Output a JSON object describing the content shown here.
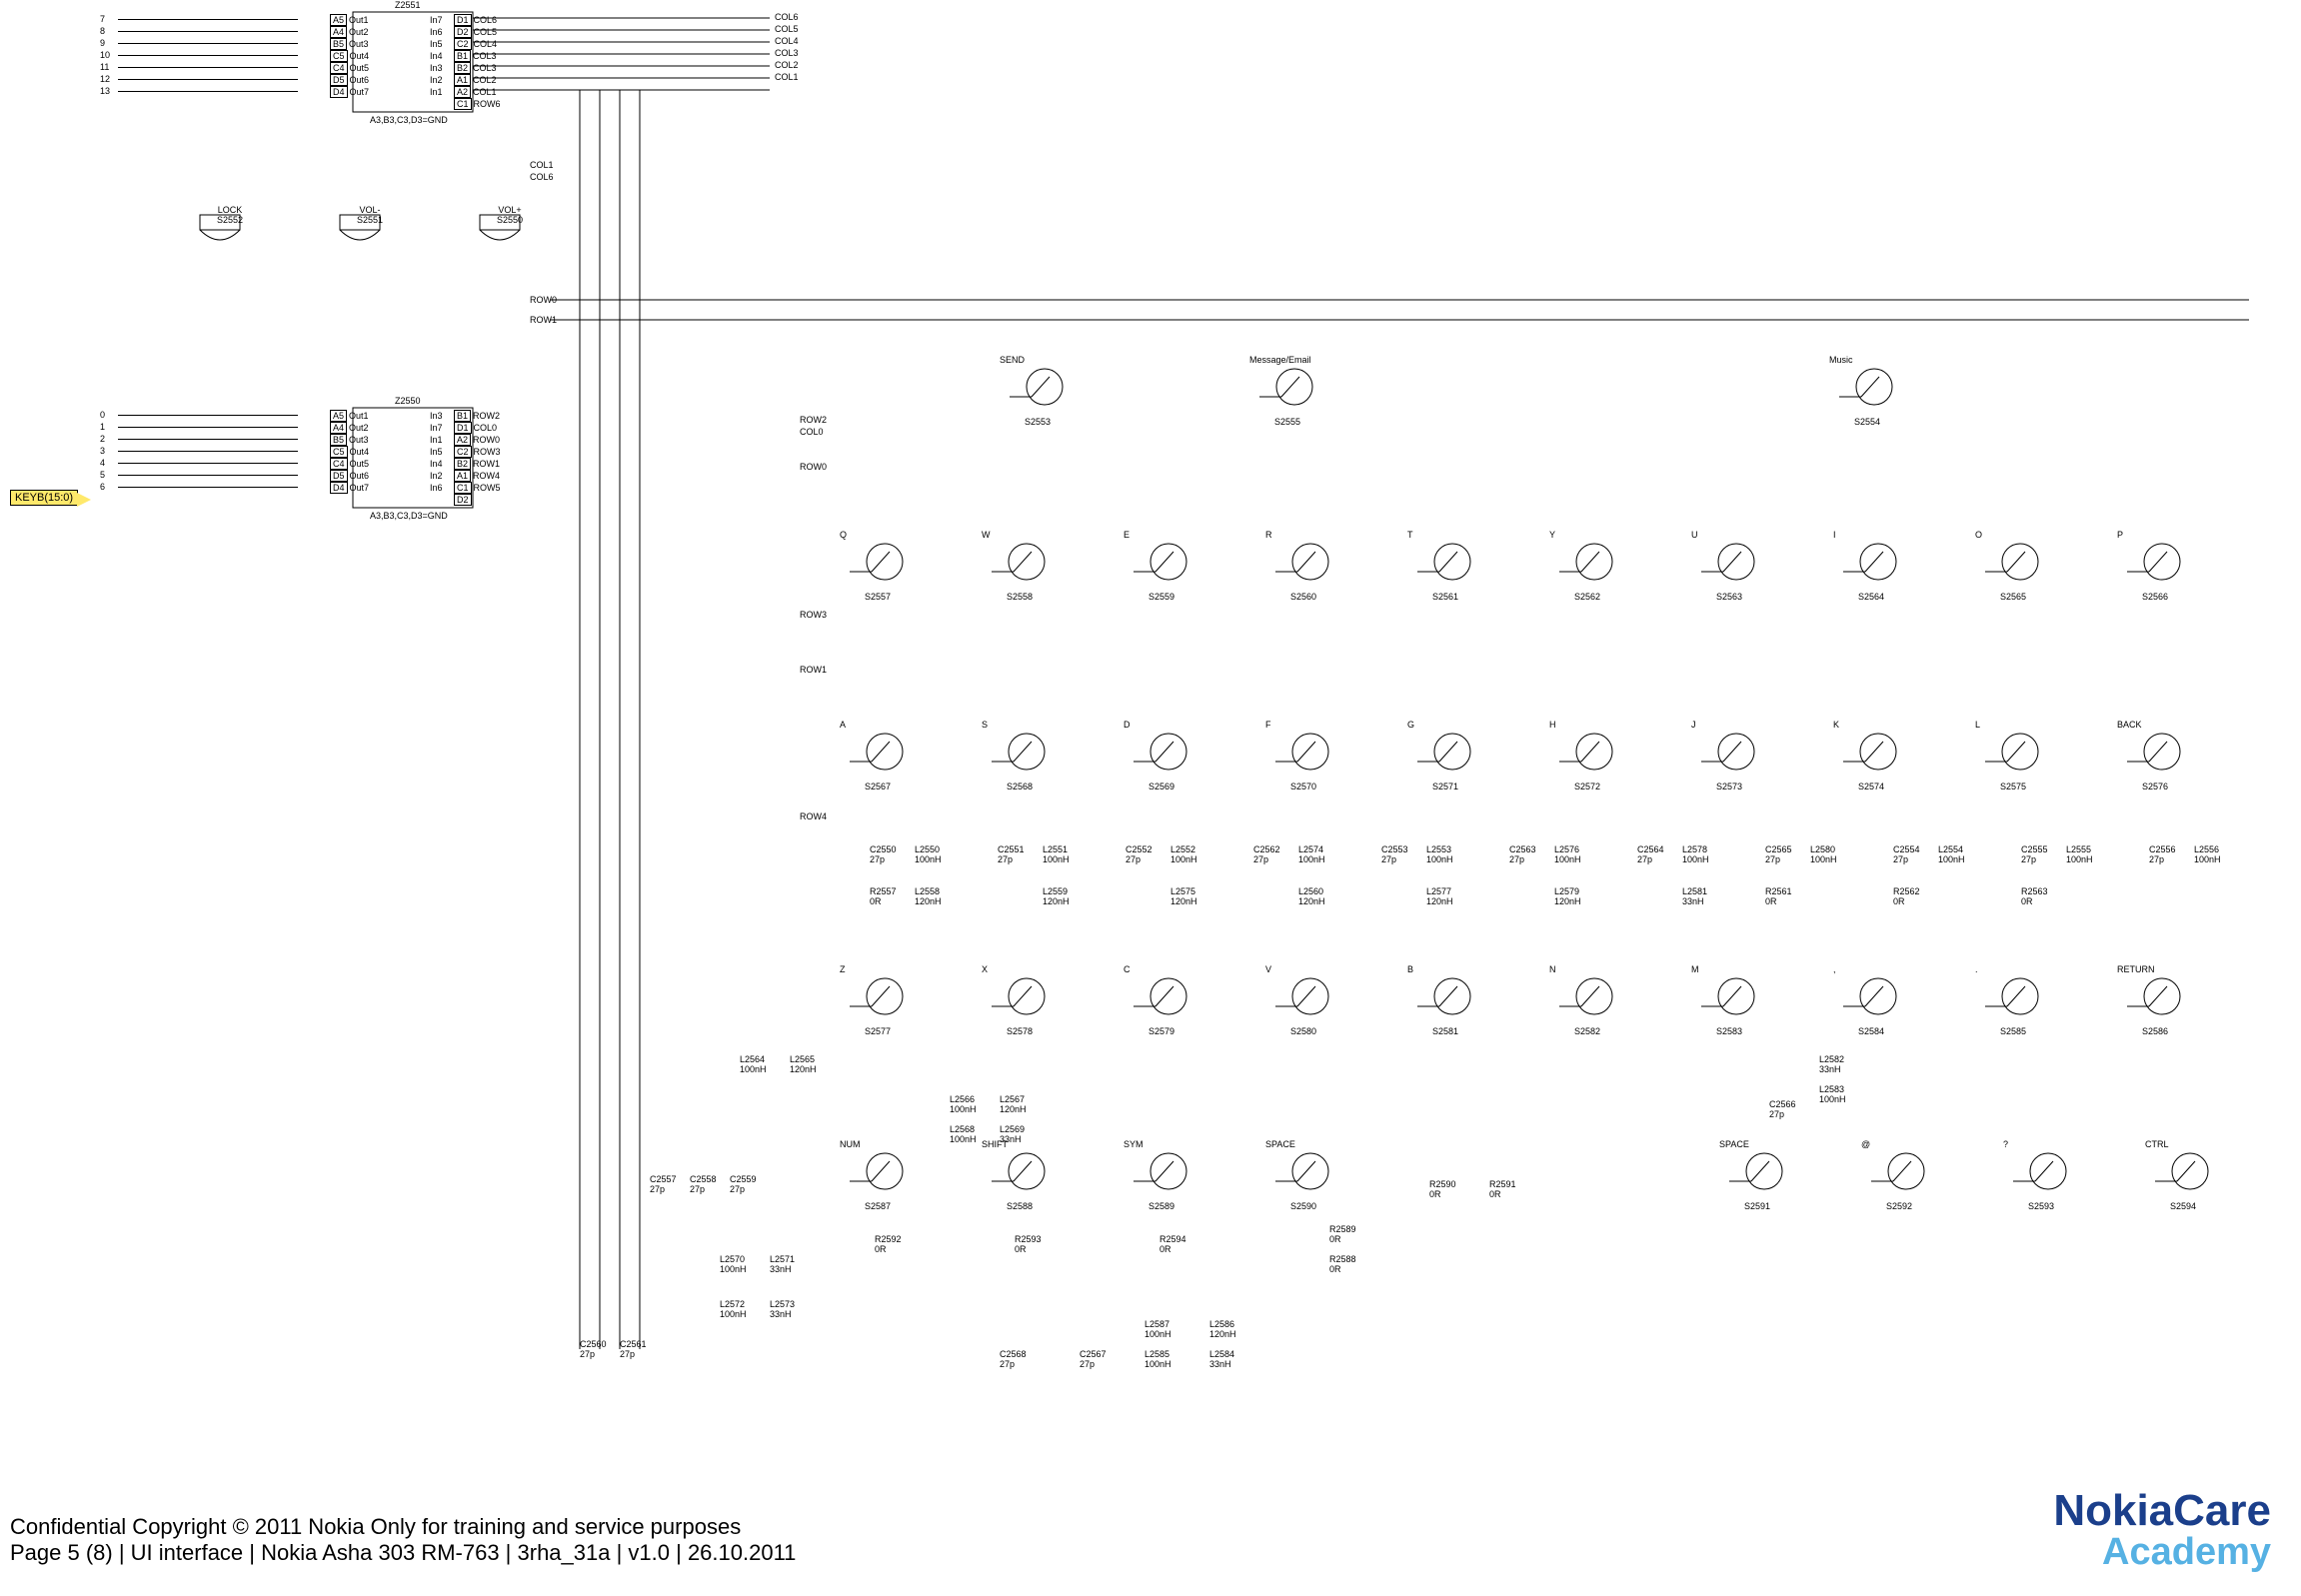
{
  "footer": {
    "copyright": "Confidential Copyright © 2011 Nokia Only for training and service purposes",
    "pageinfo": "Page 5 (8)  |  UI interface  |  Nokia Asha 303 RM-763  |  3rha_31a  |  v1.0  |  26.10.2011"
  },
  "logo": {
    "line1a": "Nokia",
    "line1b": "Care",
    "line2": "Academy"
  },
  "bus_tag": "KEYB(15:0)",
  "chips": {
    "z2551": {
      "name": "Z2551",
      "note": "A3,B3,C3,D3=GND",
      "left_pins": [
        {
          "p": "A5",
          "n": "Out1"
        },
        {
          "p": "A4",
          "n": "Out2"
        },
        {
          "p": "B5",
          "n": "Out3"
        },
        {
          "p": "C5",
          "n": "Out4"
        },
        {
          "p": "C4",
          "n": "Out5"
        },
        {
          "p": "D5",
          "n": "Out6"
        },
        {
          "p": "D4",
          "n": "Out7"
        }
      ],
      "right_pins": [
        {
          "n": "In7",
          "p": "D1",
          "net": "COL6"
        },
        {
          "n": "In6",
          "p": "D2",
          "net": "COL5"
        },
        {
          "n": "In5",
          "p": "C2",
          "net": "COL4"
        },
        {
          "n": "In4",
          "p": "B1",
          "net": "COL3"
        },
        {
          "n": "In3",
          "p": "B2",
          "net": "COL3"
        },
        {
          "n": "In2",
          "p": "A1",
          "net": "COL2"
        },
        {
          "n": "In1",
          "p": "A2",
          "net": "COL1"
        },
        {
          "n": "   ",
          "p": "C1",
          "net": "ROW6"
        }
      ]
    },
    "z2550": {
      "name": "Z2550",
      "note": "A3,B3,C3,D3=GND",
      "left_pins": [
        {
          "p": "A5",
          "n": "Out1"
        },
        {
          "p": "A4",
          "n": "Out2"
        },
        {
          "p": "B5",
          "n": "Out3"
        },
        {
          "p": "C5",
          "n": "Out4"
        },
        {
          "p": "C4",
          "n": "Out5"
        },
        {
          "p": "D5",
          "n": "Out6"
        },
        {
          "p": "D4",
          "n": "Out7"
        }
      ],
      "right_pins": [
        {
          "n": "In3",
          "p": "B1",
          "net": "ROW2"
        },
        {
          "n": "In7",
          "p": "D1",
          "net": "COL0"
        },
        {
          "n": "In1",
          "p": "A2",
          "net": "ROW0"
        },
        {
          "n": "In5",
          "p": "C2",
          "net": "ROW3"
        },
        {
          "n": "In4",
          "p": "B2",
          "net": "ROW1"
        },
        {
          "n": "In2",
          "p": "A1",
          "net": "ROW4"
        },
        {
          "n": "In6",
          "p": "C1",
          "net": "ROW5"
        },
        {
          "n": "   ",
          "p": "D2",
          "net": ""
        }
      ]
    }
  },
  "top_keys": {
    "lock": {
      "label": "LOCK",
      "ref": "S2552"
    },
    "volm": {
      "label": "VOL-",
      "ref": "S2551"
    },
    "volp": {
      "label": "VOL+",
      "ref": "S2550"
    }
  },
  "row_nets": {
    "row0": "ROW0",
    "row1": "ROW1",
    "row2": "ROW2",
    "row3": "ROW3",
    "row4": "ROW4",
    "col0": "COL0",
    "col1": "COL1",
    "col6": "COL6",
    "row0b": "ROW0"
  },
  "extra_nets": {
    "col6": "COL6",
    "col5": "COL5",
    "col4": "COL4",
    "col3": "COL3",
    "col2": "COL2",
    "col1": "COL1"
  },
  "keys_row_top": [
    {
      "label": "SEND",
      "ref": "S2553"
    },
    {
      "label": "Message/Email",
      "ref": "S2555"
    },
    {
      "label": "Music",
      "ref": "S2554"
    }
  ],
  "keys_row_q": [
    {
      "label": "Q",
      "ref": "S2557"
    },
    {
      "label": "W",
      "ref": "S2558"
    },
    {
      "label": "E",
      "ref": "S2559"
    },
    {
      "label": "R",
      "ref": "S2560"
    },
    {
      "label": "T",
      "ref": "S2561"
    },
    {
      "label": "Y",
      "ref": "S2562"
    },
    {
      "label": "U",
      "ref": "S2563"
    },
    {
      "label": "I",
      "ref": "S2564"
    },
    {
      "label": "O",
      "ref": "S2565"
    },
    {
      "label": "P",
      "ref": "S2566"
    }
  ],
  "keys_row_a": [
    {
      "label": "A",
      "ref": "S2567"
    },
    {
      "label": "S",
      "ref": "S2568"
    },
    {
      "label": "D",
      "ref": "S2569"
    },
    {
      "label": "F",
      "ref": "S2570"
    },
    {
      "label": "G",
      "ref": "S2571"
    },
    {
      "label": "H",
      "ref": "S2572"
    },
    {
      "label": "J",
      "ref": "S2573"
    },
    {
      "label": "K",
      "ref": "S2574"
    },
    {
      "label": "L",
      "ref": "S2575"
    },
    {
      "label": "BACK",
      "ref": "S2576"
    }
  ],
  "keys_row_z": [
    {
      "label": "Z",
      "ref": "S2577"
    },
    {
      "label": "X",
      "ref": "S2578"
    },
    {
      "label": "C",
      "ref": "S2579"
    },
    {
      "label": "V",
      "ref": "S2580"
    },
    {
      "label": "B",
      "ref": "S2581"
    },
    {
      "label": "N",
      "ref": "S2582"
    },
    {
      "label": "M",
      "ref": "S2583"
    },
    {
      "label": ",",
      "ref": "S2584"
    },
    {
      "label": ".",
      "ref": "S2585"
    },
    {
      "label": "RETURN",
      "ref": "S2586"
    }
  ],
  "keys_row_bottom": [
    {
      "label": "NUM",
      "ref": "S2587"
    },
    {
      "label": "SHIFT",
      "ref": "S2588"
    },
    {
      "label": "SYM",
      "ref": "S2589"
    },
    {
      "label": "SPACE",
      "ref": "S2590"
    },
    {
      "label": "SPACE",
      "ref": "S2591"
    },
    {
      "label": "@",
      "ref": "S2592"
    },
    {
      "label": "?",
      "ref": "S2593"
    },
    {
      "label": "CTRL",
      "ref": "S2594"
    }
  ],
  "filters_row": [
    {
      "c": "C2550",
      "cv": "27p",
      "l1": "L2550",
      "l1v": "100nH",
      "l2": "L2558",
      "l2v": "120nH",
      "r": "R2557",
      "rv": "0R"
    },
    {
      "c": "C2551",
      "cv": "27p",
      "l1": "L2551",
      "l1v": "100nH",
      "l2": "L2559",
      "l2v": "120nH"
    },
    {
      "c": "C2552",
      "cv": "27p",
      "l1": "L2552",
      "l1v": "100nH",
      "l2": "L2575",
      "l2v": "120nH"
    },
    {
      "c": "C2562",
      "cv": "27p",
      "l1": "L2574",
      "l1v": "100nH",
      "l2": "L2560",
      "l2v": "120nH"
    },
    {
      "c": "C2553",
      "cv": "27p",
      "l1": "L2553",
      "l1v": "100nH",
      "l2": "L2577",
      "l2v": "120nH"
    },
    {
      "c": "C2563",
      "cv": "27p",
      "l1": "L2576",
      "l1v": "100nH",
      "l2": "L2579",
      "l2v": "120nH"
    },
    {
      "c": "C2564",
      "cv": "27p",
      "l1": "L2578",
      "l1v": "100nH",
      "l2": "L2581",
      "l2v": "33nH"
    },
    {
      "c": "C2565",
      "cv": "27p",
      "l1": "L2580",
      "l1v": "100nH",
      "l2": "",
      "l2v": "",
      "r": "R2561",
      "rv": "0R"
    },
    {
      "c": "C2554",
      "cv": "27p",
      "l1": "L2554",
      "l1v": "100nH",
      "r": "R2562",
      "rv": "0R"
    },
    {
      "c": "C2555",
      "cv": "27p",
      "l1": "L2555",
      "l1v": "100nH",
      "r": "R2563",
      "rv": "0R"
    },
    {
      "c": "C2556",
      "cv": "27p",
      "l1": "L2556",
      "l1v": "100nH"
    }
  ],
  "misc_components": {
    "l2564": "L2564",
    "l2565": "L2565",
    "l2564v": "100nH",
    "l2565v": "120nH",
    "l2566": "L2566",
    "l2567": "L2567",
    "l2566v": "100nH",
    "l2567v": "120nH",
    "l2568": "L2568",
    "l2569": "L2569",
    "l2568v": "100nH",
    "l2569v": "33nH",
    "l2570": "L2570",
    "l2571": "L2571",
    "l2570v": "100nH",
    "l2571v": "33nH",
    "l2572": "L2572",
    "l2573": "L2573",
    "l2572v": "100nH",
    "l2573v": "33nH",
    "l2582": "L2582",
    "l2582v": "33nH",
    "l2583": "L2583",
    "l2583v": "100nH",
    "l2584": "L2584",
    "l2584v": "33nH",
    "l2585": "L2585",
    "l2585v": "100nH",
    "l2586": "L2586",
    "l2586v": "120nH",
    "l2587": "L2587",
    "l2587v": "100nH",
    "c2557": "C2557",
    "c2557v": "27p",
    "c2558": "C2558",
    "c2558v": "27p",
    "c2559": "C2559",
    "c2559v": "27p",
    "c2560": "C2560",
    "c2560v": "27p",
    "c2561": "C2561",
    "c2561v": "27p",
    "c2566": "C2566",
    "c2566v": "27p",
    "c2567": "C2567",
    "c2567v": "27p",
    "c2568": "C2568",
    "c2568v": "27p",
    "r2588": "R2588",
    "r2588v": "0R",
    "r2589": "R2589",
    "r2589v": "0R",
    "r2590": "R2590",
    "r2590v": "0R",
    "r2591": "R2591",
    "r2591v": "0R",
    "r2592": "R2592",
    "r2592v": "0R",
    "r2593": "R2593",
    "r2593v": "0R",
    "r2594": "R2594",
    "r2594v": "0R"
  },
  "bus_left": {
    "top": [
      "7",
      "8",
      "9",
      "10",
      "11",
      "12",
      "13"
    ],
    "bottom": [
      "0",
      "1",
      "2",
      "3",
      "4",
      "5",
      "6"
    ]
  }
}
